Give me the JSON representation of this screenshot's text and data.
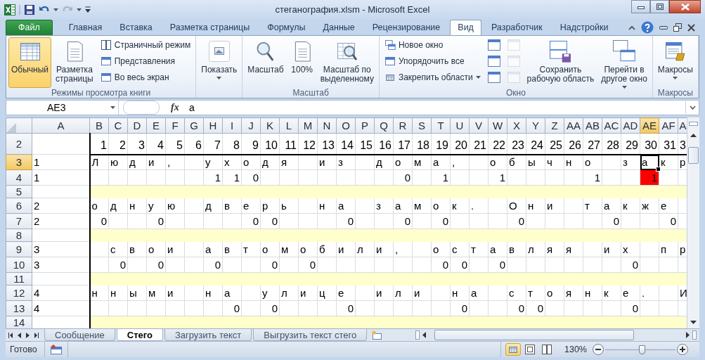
{
  "window": {
    "title": "стеганография.xlsm - Microsoft Excel"
  },
  "ribbon_tabs": [
    {
      "label": "Файл",
      "kind": "file",
      "selected": false
    },
    {
      "label": "Главная",
      "kind": "tab",
      "selected": false
    },
    {
      "label": "Вставка",
      "kind": "tab",
      "selected": false
    },
    {
      "label": "Разметка страницы",
      "kind": "tab",
      "selected": false
    },
    {
      "label": "Формулы",
      "kind": "tab",
      "selected": false
    },
    {
      "label": "Данные",
      "kind": "tab",
      "selected": false
    },
    {
      "label": "Рецензирование",
      "kind": "tab",
      "selected": false
    },
    {
      "label": "Вид",
      "kind": "tab",
      "selected": true
    },
    {
      "label": "Разработчик",
      "kind": "tab",
      "selected": false
    },
    {
      "label": "Надстройки",
      "kind": "tab",
      "selected": false
    }
  ],
  "ribbon_groups": [
    {
      "label": "Режимы просмотра книги",
      "items": [
        {
          "kind": "large",
          "label": "Обычный",
          "selected": true
        },
        {
          "kind": "large",
          "label": "Разметка\nстраницы",
          "selected": false
        },
        {
          "kind": "small",
          "label": "Страничный режим",
          "selected": false
        },
        {
          "kind": "small",
          "label": "Представления"
        },
        {
          "kind": "small",
          "label": "Во весь экран"
        }
      ]
    },
    {
      "items": [
        {
          "kind": "large",
          "label": "Показать",
          "dropdown": true
        }
      ]
    },
    {
      "label": "Масштаб",
      "items": [
        {
          "kind": "large",
          "label": "Масштаб"
        },
        {
          "kind": "large",
          "label": "100%"
        },
        {
          "kind": "large",
          "label": "Масштаб по\nвыделенному"
        }
      ]
    },
    {
      "label": "Окно",
      "items": [
        {
          "kind": "small",
          "label": "Новое окно"
        },
        {
          "kind": "small",
          "label": "Упорядочить все"
        },
        {
          "kind": "small",
          "label": "Закрепить области",
          "dropdown": true
        },
        {
          "kind": "icon"
        },
        {
          "kind": "icon"
        },
        {
          "kind": "icon"
        },
        {
          "kind": "icon",
          "disabled": true
        },
        {
          "kind": "icon",
          "disabled": true
        },
        {
          "kind": "icon",
          "disabled": true
        },
        {
          "kind": "large",
          "label": "Сохранить\nрабочую область"
        },
        {
          "kind": "large",
          "label": "Перейти в\nдругое окно",
          "dropdown": true
        }
      ]
    },
    {
      "label": "Макросы",
      "items": [
        {
          "kind": "large",
          "label": "Макросы",
          "dropdown": true
        }
      ]
    }
  ],
  "formula_bar": {
    "name_box": "AE3",
    "function_label": "fx",
    "value": "а"
  },
  "sheet": {
    "columns": [
      {
        "label": "A",
        "selected": false
      },
      {
        "label": "B",
        "selected": false
      },
      {
        "label": "C",
        "selected": false
      },
      {
        "label": "D",
        "selected": false
      },
      {
        "label": "E",
        "selected": false
      },
      {
        "label": "F",
        "selected": false
      },
      {
        "label": "G",
        "selected": false
      },
      {
        "label": "H",
        "selected": false
      },
      {
        "label": "I",
        "selected": false
      },
      {
        "label": "J",
        "selected": false
      },
      {
        "label": "K",
        "selected": false
      },
      {
        "label": "L",
        "selected": false
      },
      {
        "label": "M",
        "selected": false
      },
      {
        "label": "N",
        "selected": false
      },
      {
        "label": "O",
        "selected": false
      },
      {
        "label": "P",
        "selected": false
      },
      {
        "label": "Q",
        "selected": false
      },
      {
        "label": "R",
        "selected": false
      },
      {
        "label": "S",
        "selected": false
      },
      {
        "label": "T",
        "selected": false
      },
      {
        "label": "U",
        "selected": false
      },
      {
        "label": "V",
        "selected": false
      },
      {
        "label": "W",
        "selected": false
      },
      {
        "label": "X",
        "selected": false
      },
      {
        "label": "Y",
        "selected": false
      },
      {
        "label": "Z",
        "selected": false
      },
      {
        "label": "AA",
        "selected": false
      },
      {
        "label": "AB",
        "selected": false
      },
      {
        "label": "AC",
        "selected": false
      },
      {
        "label": "AD",
        "selected": false
      },
      {
        "label": "AE",
        "selected": true
      },
      {
        "label": "AF",
        "selected": false
      },
      {
        "label": "A",
        "selected": false
      }
    ],
    "rows": [
      {
        "header": "2",
        "kind": "numbers",
        "selected": false,
        "cells": [
          null,
          "1",
          "2",
          "3",
          "4",
          "5",
          "6",
          "7",
          "8",
          "9",
          "10",
          "11",
          "12",
          "13",
          "14",
          "15",
          "16",
          "17",
          "18",
          "19",
          "20",
          "21",
          "22",
          "23",
          "24",
          "25",
          "26",
          "27",
          "28",
          "29",
          "30",
          "31",
          "3"
        ]
      },
      {
        "header": "3",
        "kind": "text",
        "selected": true,
        "cells": [
          "1",
          "Л",
          "ю",
          "д",
          "и",
          ",",
          null,
          "у",
          "х",
          "о",
          "д",
          "я",
          null,
          "и",
          "з",
          null,
          "д",
          "о",
          "м",
          "а",
          ",",
          null,
          "о",
          "б",
          "ы",
          "ч",
          "н",
          "о",
          null,
          "з",
          "а",
          "к",
          "р"
        ]
      },
      {
        "header": "4",
        "kind": "bits",
        "selected": false,
        "cells": [
          "1",
          null,
          null,
          null,
          null,
          null,
          null,
          "1",
          "1",
          "0",
          null,
          null,
          null,
          null,
          null,
          null,
          null,
          "0",
          null,
          "1",
          null,
          null,
          "1",
          null,
          null,
          null,
          null,
          "1",
          null,
          null,
          {
            "text": "1",
            "color": "#ff0000"
          },
          null,
          null
        ]
      },
      {
        "header": "5",
        "kind": "spacer",
        "selected": false
      },
      {
        "header": "6",
        "kind": "text",
        "selected": false,
        "cells": [
          "2",
          "о",
          "д",
          "н",
          "у",
          "ю",
          null,
          "д",
          "в",
          "е",
          "р",
          "ь",
          null,
          "н",
          "а",
          null,
          "з",
          "а",
          "м",
          "о",
          "к",
          ".",
          null,
          "О",
          "н",
          "и",
          null,
          "т",
          "а",
          "к",
          "ж",
          "е",
          null
        ]
      },
      {
        "header": "7",
        "kind": "bits",
        "selected": false,
        "cells": [
          "2",
          "0",
          null,
          null,
          "0",
          null,
          null,
          null,
          null,
          "0",
          "0",
          null,
          null,
          null,
          "0",
          null,
          null,
          "0",
          null,
          "0",
          null,
          null,
          null,
          "0",
          null,
          null,
          null,
          null,
          "0",
          null,
          null,
          "0",
          null
        ]
      },
      {
        "header": "8",
        "kind": "spacer",
        "selected": false
      },
      {
        "header": "9",
        "kind": "text",
        "selected": false,
        "cells": [
          "3",
          null,
          "с",
          "в",
          "о",
          "и",
          null,
          "а",
          "в",
          "т",
          "о",
          "м",
          "о",
          "б",
          "и",
          "л",
          "и",
          ",",
          null,
          "о",
          "с",
          "т",
          "а",
          "в",
          "л",
          "я",
          "я",
          null,
          "и",
          "х",
          null,
          "п",
          "р"
        ]
      },
      {
        "header": "10",
        "kind": "bits",
        "selected": false,
        "cells": [
          "3",
          null,
          "0",
          null,
          "0",
          null,
          null,
          "0",
          null,
          null,
          "0",
          null,
          "0",
          null,
          null,
          null,
          null,
          null,
          null,
          "0",
          "0",
          null,
          "0",
          null,
          null,
          null,
          null,
          null,
          null,
          "0",
          null,
          null,
          null
        ]
      },
      {
        "header": "11",
        "kind": "spacer",
        "selected": false
      },
      {
        "header": "12",
        "kind": "text",
        "selected": false,
        "cells": [
          "4",
          "н",
          "н",
          "ы",
          "м",
          "и",
          null,
          "н",
          "а",
          null,
          "у",
          "л",
          "и",
          "ц",
          "е",
          null,
          "и",
          "л",
          "и",
          null,
          "н",
          "а",
          null,
          "с",
          "т",
          "о",
          "я",
          "н",
          "к",
          "е",
          ".",
          null,
          "И"
        ]
      },
      {
        "header": "13",
        "kind": "bits",
        "selected": false,
        "cells": [
          "4",
          null,
          null,
          null,
          null,
          null,
          null,
          null,
          "0",
          null,
          "0",
          null,
          null,
          null,
          "0",
          null,
          null,
          null,
          null,
          null,
          "0",
          null,
          null,
          "0",
          "0",
          null,
          null,
          null,
          null,
          "0",
          null,
          null,
          null
        ]
      },
      {
        "header": "14",
        "kind": "spacer",
        "selected": false
      }
    ]
  },
  "sheet_tabs": [
    {
      "label": "Сообщение",
      "selected": false
    },
    {
      "label": "Стего",
      "selected": true
    },
    {
      "label": "Загрузить текст",
      "selected": false
    },
    {
      "label": "Выгрузить текст стего",
      "selected": false
    }
  ],
  "status_bar": {
    "text": "Готово",
    "view_buttons": [
      {
        "selected": true
      },
      {
        "selected": false
      },
      {
        "selected": false
      }
    ],
    "zoom": {
      "reading": "130%",
      "level": 0.52
    }
  }
}
